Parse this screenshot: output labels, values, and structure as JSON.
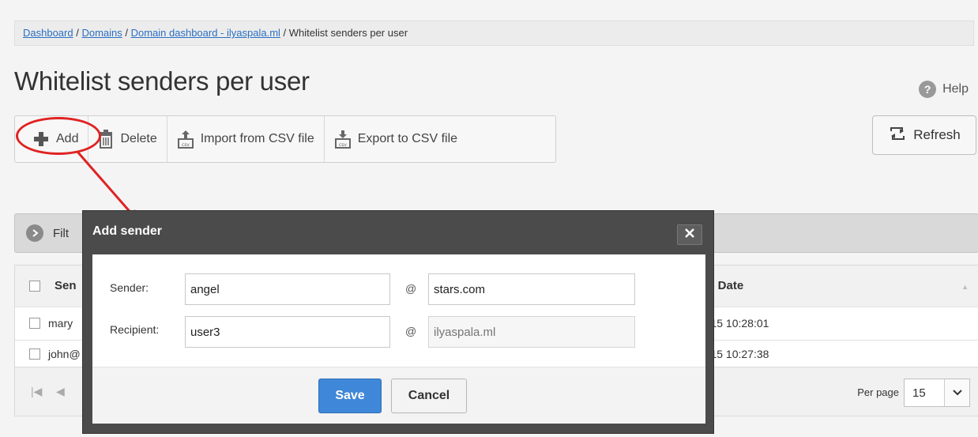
{
  "breadcrumb": {
    "links": [
      "Dashboard",
      "Domains",
      "Domain dashboard - ilyaspala.ml"
    ],
    "separator": " / ",
    "current": "Whitelist senders per user"
  },
  "page_title": "Whitelist senders per user",
  "help_label": "Help",
  "toolbar": {
    "add_label": "Add",
    "delete_label": "Delete",
    "import_label": "Import from CSV file",
    "export_label": "Export to CSV file",
    "refresh_label": "Refresh"
  },
  "filter_label": "Filt",
  "grid": {
    "header_sender": "Sen",
    "header_date": "ed Date",
    "rows": [
      {
        "sender": "mary",
        "date": "5-15 10:28:01"
      },
      {
        "sender": "john@",
        "date": "5-15 10:27:38"
      }
    ]
  },
  "pager": {
    "first_icon": "|◀",
    "prev_icon": "◀",
    "per_page_label": "Per page",
    "per_page_value": "15"
  },
  "modal": {
    "title": "Add sender",
    "sender_label": "Sender:",
    "sender_local_value": "angel",
    "sender_domain_value": "stars.com",
    "recipient_label": "Recipient:",
    "recipient_local_value": "user3",
    "recipient_domain_placeholder": "ilyaspala.ml",
    "at_symbol": "@",
    "save_label": "Save",
    "cancel_label": "Cancel"
  },
  "colors": {
    "accent_save": "#3f87d8",
    "highlight_red": "#e02222",
    "modal_frame": "#4b4b4b"
  }
}
